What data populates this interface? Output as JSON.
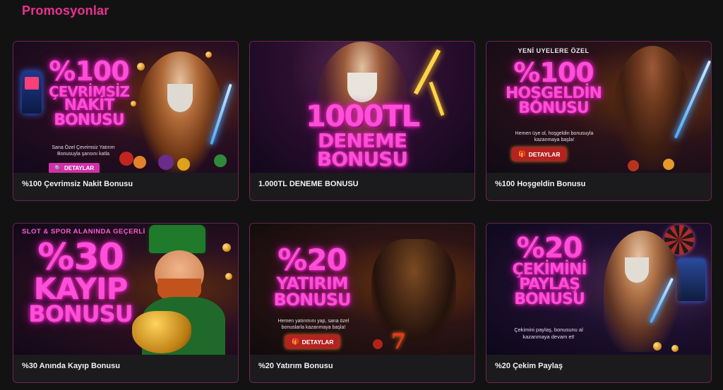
{
  "page": {
    "title": "Promosyonlar"
  },
  "cards": [
    {
      "caption": "%100 Çevrimsiz Nakit Bonusu",
      "headline": [
        "%100",
        "ÇEVRİMSİZ",
        "NAKİT",
        "BONUSU"
      ],
      "sub": "Sana Özel Çevrimsiz Yatırım Bonusuyla şansını katla",
      "button": "DETAYLAR"
    },
    {
      "caption": "1.000TL DENEME BONUSU",
      "headline": [
        "1000TL",
        "DENEME",
        "BONUSU"
      ]
    },
    {
      "caption": "%100 Hoşgeldin Bonusu",
      "eyebrow": "YENİ UYELERE ÖZEL",
      "headline": [
        "%100",
        "HOŞGELDİN",
        "BONUSU"
      ],
      "sub": "Hemen üye ol, hoşgeldin bonusuyla kazanmaya başla!",
      "button": "DETAYLAR"
    },
    {
      "caption": "%30 Anında Kayıp Bonusu",
      "eyebrow": "SLOT & SPOR ALANINDA GEÇERLİ",
      "headline": [
        "%30",
        "KAYIP",
        "BONUSU"
      ]
    },
    {
      "caption": "%20 Yatırım Bonusu",
      "headline": [
        "%20",
        "YATIRIM",
        "BONUSU"
      ],
      "sub": "Hemen yatırımını yap, sana özel bonuslarla kazanmaya başla!",
      "button": "DETAYLAR"
    },
    {
      "caption": "%20 Çekim Paylaş",
      "headline": [
        "%20",
        "ÇEKİMİNİ",
        "PAYLAŞ",
        "BONUSU"
      ],
      "sub": "Çekimini paylaş, bonusunu al kazanmaya devam et!"
    }
  ],
  "colors": {
    "accent": "#e8318f",
    "background": "#131213",
    "card": "#1b1a1c",
    "border": "#6a2550"
  }
}
